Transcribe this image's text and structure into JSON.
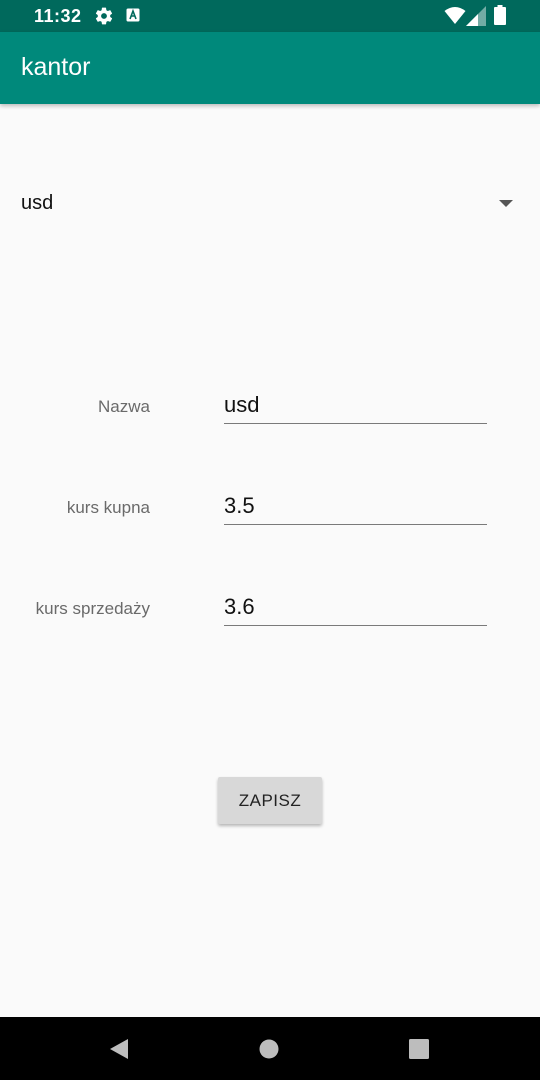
{
  "status_bar": {
    "time": "11:32",
    "icons": [
      "gear-icon",
      "a-icon",
      "wifi-icon",
      "signal-icon",
      "battery-icon"
    ]
  },
  "app_bar": {
    "title": "kantor",
    "color": "#00897b"
  },
  "currency_spinner": {
    "selected_value": "usd"
  },
  "form": {
    "name_label": "Nazwa",
    "name_value": "usd",
    "buy_rate_label": "kurs kupna",
    "buy_rate_value": "3.5",
    "sell_rate_label": "kurs sprzedaży",
    "sell_rate_value": "3.6"
  },
  "save_button": {
    "label": "ZAPISZ"
  },
  "nav_bar": {
    "icons": [
      "back-icon",
      "home-icon",
      "recents-icon"
    ]
  }
}
